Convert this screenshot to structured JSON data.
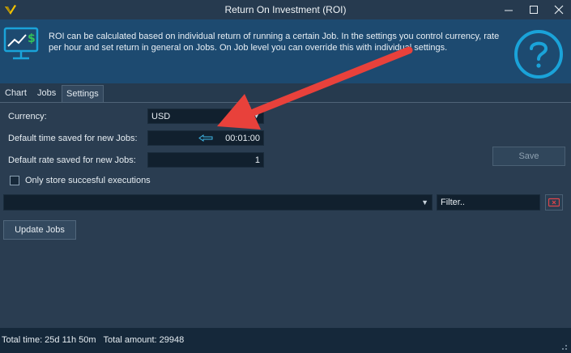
{
  "window": {
    "title": "Return On Investment (ROI)"
  },
  "banner": {
    "text": "ROI can be calculated based on individual return of running a certain Job. In the settings you control currency, rate per hour and set return in general on Jobs. On Job level you can override this with individual settings."
  },
  "tabs": [
    {
      "label": "Chart"
    },
    {
      "label": "Jobs"
    },
    {
      "label": "Settings",
      "active": true
    }
  ],
  "settings": {
    "currency_label": "Currency:",
    "currency_value": "USD",
    "time_label": "Default time saved for new Jobs:",
    "time_value": "00:01:00",
    "rate_label": "Default rate saved for new Jobs:",
    "rate_value": "1",
    "checkbox_label": "Only store succesful executions",
    "save_label": "Save",
    "filter_placeholder": "Filter..",
    "update_label": "Update Jobs"
  },
  "status": {
    "text": "Total time: 25d 11h 50m   Total amount: 29948"
  },
  "colors": {
    "accent": "#1aa3d9",
    "banner": "#1d4a70",
    "annotation_arrow": "#e8413b",
    "clear_icon": "#e0454a"
  },
  "icons": {
    "app": "app-logo-icon",
    "banner": "monitor-dollar-icon",
    "help": "question-circle-icon"
  }
}
